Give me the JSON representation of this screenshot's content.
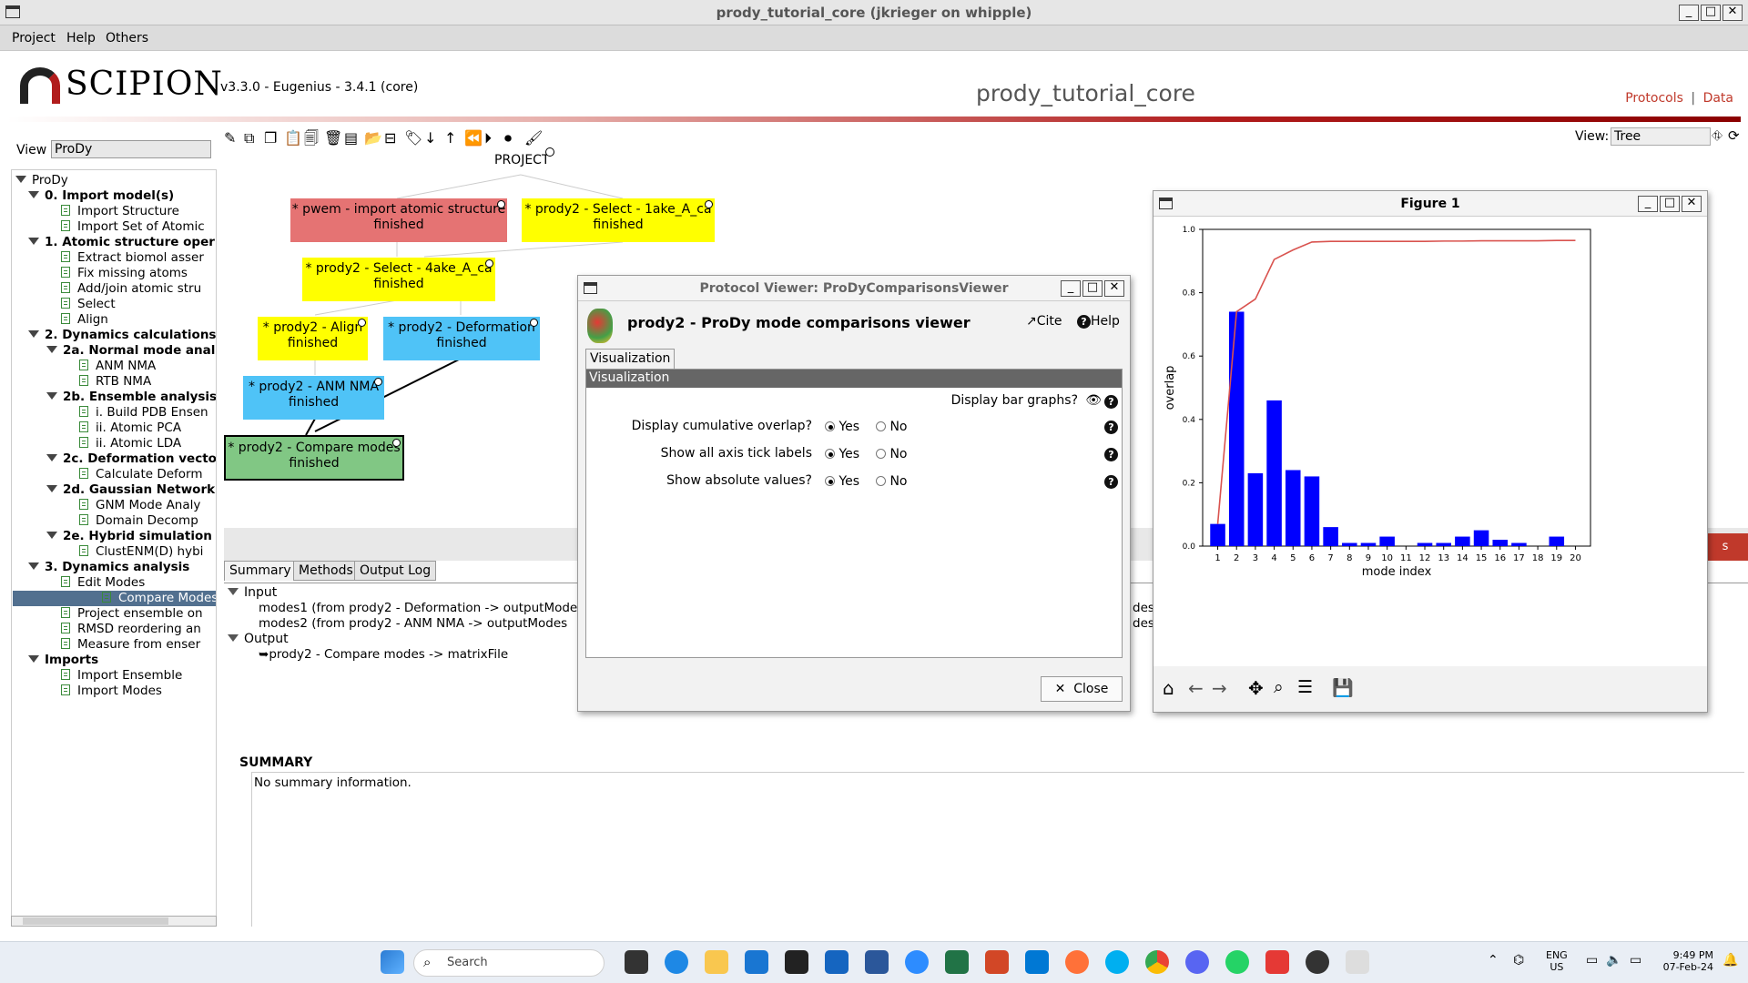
{
  "window": {
    "title": "prody_tutorial_core (jkrieger on whipple)"
  },
  "menu": [
    "Project",
    "Help",
    "Others"
  ],
  "header": {
    "logo": "SCIPION",
    "version": "v3.3.0 - Eugenius - 3.4.1 (core)",
    "project": "prody_tutorial_core",
    "link_protocols": "Protocols",
    "link_sep": "|",
    "link_data": "Data"
  },
  "left": {
    "view_label": "View",
    "view_value": "ProDy",
    "tree": [
      {
        "t": "ProDy",
        "lvl": 0,
        "kind": "folder",
        "bold": false
      },
      {
        "t": "0. Import model(s)",
        "lvl": 1,
        "kind": "folder",
        "bold": true
      },
      {
        "t": "Import Structure",
        "lvl": 2,
        "kind": "doc"
      },
      {
        "t": "Import Set of Atomic",
        "lvl": 2,
        "kind": "doc"
      },
      {
        "t": "1. Atomic structure oper",
        "lvl": 1,
        "kind": "folder",
        "bold": true
      },
      {
        "t": "Extract biomol asser",
        "lvl": 2,
        "kind": "doc"
      },
      {
        "t": "Fix missing atoms",
        "lvl": 2,
        "kind": "doc"
      },
      {
        "t": "Add/join atomic stru",
        "lvl": 2,
        "kind": "doc"
      },
      {
        "t": "Select",
        "lvl": 2,
        "kind": "doc"
      },
      {
        "t": "Align",
        "lvl": 2,
        "kind": "doc"
      },
      {
        "t": "2. Dynamics calculations",
        "lvl": 1,
        "kind": "folder",
        "bold": true
      },
      {
        "t": "2a. Normal mode anal",
        "lvl": 2,
        "kind": "folder",
        "bold": true
      },
      {
        "t": "ANM NMA",
        "lvl": 3,
        "kind": "doc"
      },
      {
        "t": "RTB NMA",
        "lvl": 3,
        "kind": "doc"
      },
      {
        "t": "2b. Ensemble analysis",
        "lvl": 2,
        "kind": "folder",
        "bold": true
      },
      {
        "t": "i. Build PDB Ensen",
        "lvl": 3,
        "kind": "doc"
      },
      {
        "t": "ii. Atomic PCA",
        "lvl": 3,
        "kind": "doc"
      },
      {
        "t": "ii. Atomic LDA",
        "lvl": 3,
        "kind": "doc"
      },
      {
        "t": "2c. Deformation vecto",
        "lvl": 2,
        "kind": "folder",
        "bold": true
      },
      {
        "t": "Calculate Deform",
        "lvl": 3,
        "kind": "doc"
      },
      {
        "t": "2d. Gaussian Network",
        "lvl": 2,
        "kind": "folder",
        "bold": true
      },
      {
        "t": "GNM Mode Analy",
        "lvl": 3,
        "kind": "doc"
      },
      {
        "t": "Domain Decomp",
        "lvl": 3,
        "kind": "doc"
      },
      {
        "t": "2e. Hybrid simulation",
        "lvl": 2,
        "kind": "folder",
        "bold": true
      },
      {
        "t": "ClustENM(D) hybi",
        "lvl": 3,
        "kind": "doc"
      },
      {
        "t": "3. Dynamics analysis",
        "lvl": 1,
        "kind": "folder",
        "bold": true
      },
      {
        "t": "Edit Modes",
        "lvl": 2,
        "kind": "doc"
      },
      {
        "t": "Compare Modes",
        "lvl": 2,
        "kind": "doc",
        "selected": true
      },
      {
        "t": "Project ensemble on",
        "lvl": 2,
        "kind": "doc"
      },
      {
        "t": "RMSD reordering an",
        "lvl": 2,
        "kind": "doc"
      },
      {
        "t": "Measure from enser",
        "lvl": 2,
        "kind": "doc"
      },
      {
        "t": "Imports",
        "lvl": 1,
        "kind": "folder",
        "bold": true
      },
      {
        "t": "Import Ensemble",
        "lvl": 2,
        "kind": "doc"
      },
      {
        "t": "Import Modes",
        "lvl": 2,
        "kind": "doc"
      }
    ]
  },
  "graph": {
    "view_label": "View:",
    "view_value": "Tree",
    "root": "PROJECT",
    "nodes": [
      {
        "l1": "* pwem - import atomic structure",
        "l2": "finished",
        "color": "#e57373"
      },
      {
        "l1": "* prody2 - Select - 1ake_A_ca",
        "l2": "finished",
        "color": "#ffff00"
      },
      {
        "l1": "* prody2 - Select - 4ake_A_ca",
        "l2": "finished",
        "color": "#ffff00"
      },
      {
        "l1": "* prody2 - Align",
        "l2": "finished",
        "color": "#ffff00"
      },
      {
        "l1": "* prody2 - Deformation",
        "l2": "finished",
        "color": "#4fc3f7"
      },
      {
        "l1": "* prody2 - ANM NMA",
        "l2": "finished",
        "color": "#4fc3f7"
      },
      {
        "l1": "* prody2 - Compare modes",
        "l2": "finished",
        "color": "#81c784"
      }
    ]
  },
  "bottom": {
    "tabs": [
      "Summary",
      "Methods",
      "Output Log"
    ],
    "input_label": "Input",
    "modes1": "modes1   (from prody2 - Deformation -> outputMode",
    "modes2": "modes2   (from prody2 - ANM NMA -> outputModes",
    "output_label": "Output",
    "output_item": "prody2 - Compare modes -> matrixFile",
    "summary_title": "SUMMARY",
    "summary_text": "No summary information.",
    "right_frag1": "des",
    "right_frag2": "des",
    "right_btn": "s"
  },
  "viewer": {
    "title": "Protocol Viewer: ProDyComparisonsViewer",
    "heading": "prody2 - ProDy mode comparisons viewer",
    "cite": "Cite",
    "help": "Help",
    "tab": "Visualization",
    "section": "Visualization",
    "bar_graphs": "Display bar graphs?",
    "rows": [
      {
        "label": "Display cumulative overlap?",
        "yes": "Yes",
        "no": "No"
      },
      {
        "label": "Show all axis tick labels",
        "yes": "Yes",
        "no": "No"
      },
      {
        "label": "Show absolute values?",
        "yes": "Yes",
        "no": "No"
      }
    ],
    "close": "Close"
  },
  "figure": {
    "title": "Figure 1"
  },
  "chart_data": {
    "type": "bar",
    "xlabel": "mode index",
    "ylabel": "overlap",
    "ylim": [
      0,
      1.0
    ],
    "yticks": [
      "0.0",
      "0.2",
      "0.4",
      "0.6",
      "0.8",
      "1.0"
    ],
    "categories": [
      "1",
      "2",
      "3",
      "4",
      "5",
      "6",
      "7",
      "8",
      "9",
      "10",
      "11",
      "12",
      "13",
      "14",
      "15",
      "16",
      "17",
      "18",
      "19",
      "20"
    ],
    "values": [
      0.07,
      0.74,
      0.23,
      0.46,
      0.24,
      0.22,
      0.06,
      0.01,
      0.01,
      0.03,
      0.0,
      0.01,
      0.01,
      0.03,
      0.05,
      0.02,
      0.01,
      0.0,
      0.03,
      0.0
    ],
    "cumulative": [
      0.07,
      0.74,
      0.78,
      0.905,
      0.935,
      0.96,
      0.962,
      0.962,
      0.962,
      0.962,
      0.962,
      0.962,
      0.963,
      0.963,
      0.964,
      0.964,
      0.964,
      0.964,
      0.965,
      0.965
    ],
    "bar_color": "#0000ff",
    "line_color": "#d9534f"
  },
  "taskbar": {
    "search": "Search",
    "lang1": "ENG",
    "lang2": "US",
    "time": "9:49 PM",
    "date": "07-Feb-24"
  }
}
